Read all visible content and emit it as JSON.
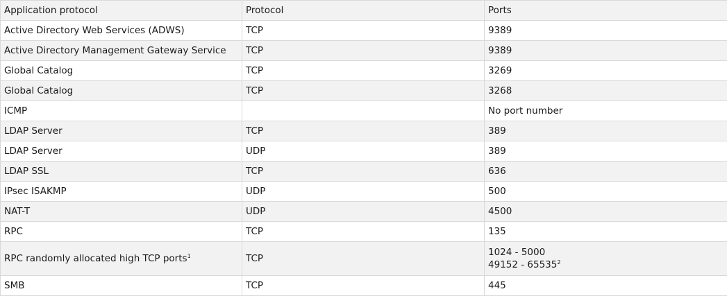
{
  "table": {
    "headers": [
      "Application protocol",
      "Protocol",
      "Ports"
    ],
    "rows": [
      {
        "app": "Active Directory Web Services (ADWS)",
        "protocol": "TCP",
        "ports": "9389"
      },
      {
        "app": "Active Directory Management Gateway Service",
        "protocol": "TCP",
        "ports": "9389"
      },
      {
        "app": "Global Catalog",
        "protocol": "TCP",
        "ports": "3269"
      },
      {
        "app": "Global Catalog",
        "protocol": "TCP",
        "ports": "3268"
      },
      {
        "app": "ICMP",
        "protocol": "",
        "ports": "No port number"
      },
      {
        "app": "LDAP Server",
        "protocol": "TCP",
        "ports": "389"
      },
      {
        "app": "LDAP Server",
        "protocol": "UDP",
        "ports": "389"
      },
      {
        "app": "LDAP SSL",
        "protocol": "TCP",
        "ports": "636"
      },
      {
        "app": "IPsec ISAKMP",
        "protocol": "UDP",
        "ports": "500"
      },
      {
        "app": "NAT-T",
        "protocol": "UDP",
        "ports": "4500"
      },
      {
        "app": "RPC",
        "protocol": "TCP",
        "ports": "135"
      },
      {
        "app": "RPC randomly allocated high TCP ports",
        "app_footnote": "1",
        "protocol": "TCP",
        "ports_line1": "1024 - 5000",
        "ports_line2": "49152 - 65535",
        "ports_line2_footnote": "2"
      },
      {
        "app": "SMB",
        "protocol": "TCP",
        "ports": "445"
      }
    ]
  }
}
